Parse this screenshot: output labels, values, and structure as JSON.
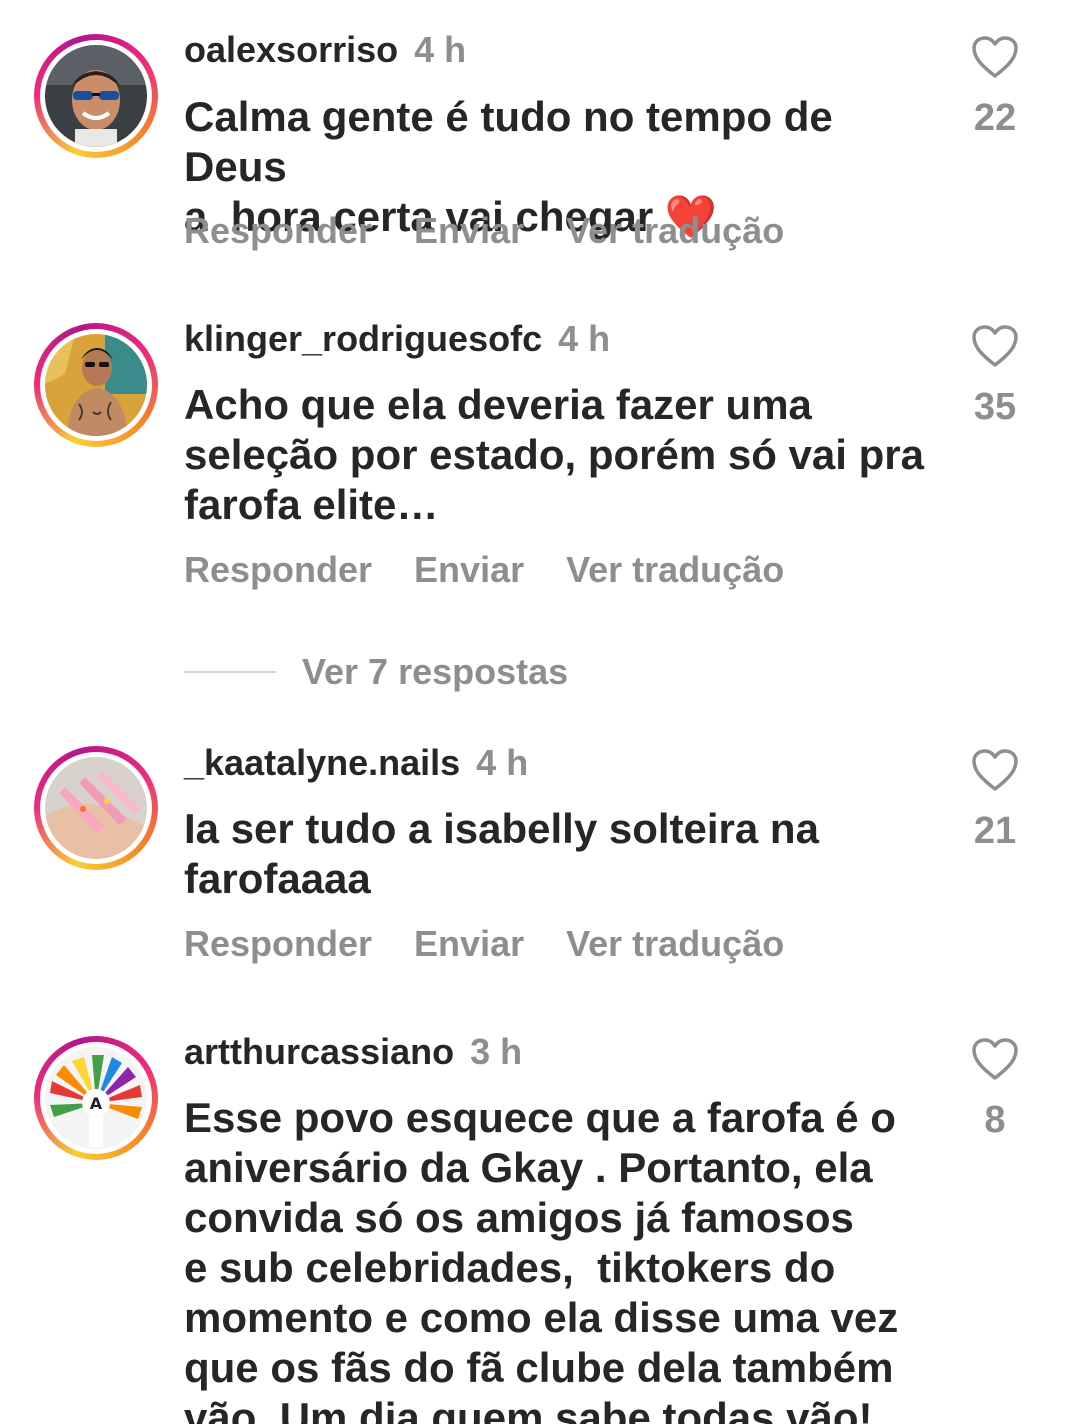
{
  "comments": [
    {
      "username": "oalexsorriso",
      "time": "4 h",
      "text": "Calma gente é tudo no tempo de Deus\na  hora certa vai chegar ❤️",
      "likes": "22",
      "avatar": "selfie-sunglasses-avatar"
    },
    {
      "username": "klinger_rodriguesofc",
      "time": "4 h",
      "text": "Acho que ela deveria fazer uma\nseleção por estado, porém só vai pra\nfarofa elite…",
      "likes": "35",
      "avatar": "tattooed-man-avatar"
    },
    {
      "username": "_kaatalyne.nails",
      "time": "4 h",
      "text": "Ia ser tudo a isabelly solteira na\nfarofaaaa",
      "likes": "21",
      "avatar": "pink-nails-avatar"
    },
    {
      "username": "artthurcassiano",
      "time": "3 h",
      "text": "Esse povo esquece que a farofa é o\naniversário da Gkay . Portanto, ela\nconvida só os amigos já famosos\ne sub celebridades,  tiktokers do\nmomento e como ela disse uma vez\nque os fãs do fã clube dela também\nvão. Um dia quem sabe todas vão!",
      "likes": "8",
      "avatar": "rainbow-headdress-avatar"
    }
  ],
  "actions": {
    "reply": "Responder",
    "send": "Enviar",
    "translate": "Ver tradução"
  },
  "view_replies": "Ver 7 respostas",
  "colors": {
    "text": "#262626",
    "secondary": "#8e8e8e",
    "ring_start": "#f9ce34",
    "ring_mid": "#ee2a7b",
    "ring_end": "#b3168c"
  },
  "icons": {
    "like": "heart-outline-icon"
  }
}
